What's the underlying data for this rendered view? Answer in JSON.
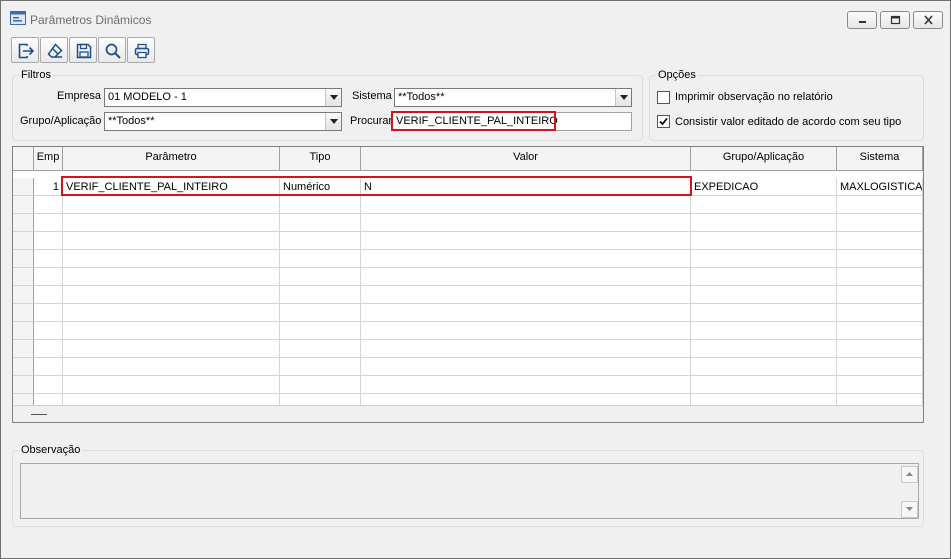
{
  "window": {
    "title": "Parâmetros Dinâmicos"
  },
  "toolbar": {
    "buttons": [
      {
        "name": "exit",
        "icon": "exit-icon"
      },
      {
        "name": "clear",
        "icon": "eraser-icon"
      },
      {
        "name": "save",
        "icon": "save-icon"
      },
      {
        "name": "search",
        "icon": "search-icon"
      },
      {
        "name": "print",
        "icon": "print-icon"
      }
    ]
  },
  "filters": {
    "legend": "Filtros",
    "empresa_label": "Empresa",
    "empresa_value": "01 MODELO - 1",
    "grupo_label": "Grupo/Aplicação",
    "grupo_value": "**Todos**",
    "sistema_label": "Sistema",
    "sistema_value": "**Todos**",
    "procurar_label": "Procurar",
    "procurar_value": "VERIF_CLIENTE_PAL_INTEIRO"
  },
  "options": {
    "legend": "Opções",
    "items": [
      {
        "label": "Imprimir observação no relatório",
        "checked": false
      },
      {
        "label": "Consistir valor editado de acordo com seu tipo",
        "checked": true
      }
    ]
  },
  "grid": {
    "columns": [
      "Emp",
      "Parâmetro",
      "Tipo",
      "Valor",
      "Grupo/Aplicação",
      "Sistema"
    ],
    "rows": [
      [
        "1",
        "VERIF_CLIENTE_PAL_INTEIRO",
        "Numérico",
        "N",
        "EXPEDICAO",
        "MAXLOGISTICA"
      ]
    ]
  },
  "observation": {
    "legend": "Observação",
    "text": ""
  },
  "colors": {
    "highlight": "#d4141c",
    "window_bg": "#f0f0f0"
  }
}
